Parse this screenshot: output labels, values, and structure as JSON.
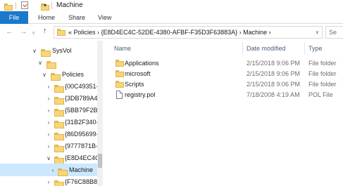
{
  "window": {
    "title": "Machine",
    "quick_access_dropdown": "▾"
  },
  "ribbon": {
    "tabs": [
      {
        "label": "File"
      },
      {
        "label": "Home"
      },
      {
        "label": "Share"
      },
      {
        "label": "View"
      }
    ]
  },
  "nav": {
    "back": "←",
    "forward": "→",
    "recent": "∨",
    "up": "↑"
  },
  "address": {
    "path": "«  Policies  ›  {E8D4EC4C-52DE-4380-AFBF-F35D3F63883A}  ›  Machine  ›",
    "chevron": "∨"
  },
  "search": {
    "placeholder": "Se"
  },
  "tree": [
    {
      "label": "SysVol",
      "arrow": "∨"
    },
    {
      "label": "",
      "arrow": "∨"
    },
    {
      "label": "Policies",
      "arrow": "∨"
    },
    {
      "label": "{00C49351-",
      "arrow": "›"
    },
    {
      "label": "{3DB789A4",
      "arrow": "›"
    },
    {
      "label": "{5BB79F2B-",
      "arrow": "›"
    },
    {
      "label": "{31B2F340-",
      "arrow": "›"
    },
    {
      "label": "{86D95699-",
      "arrow": "›"
    },
    {
      "label": "{9777871B-",
      "arrow": "›"
    },
    {
      "label": "{E8D4EC4C",
      "arrow": "∨"
    },
    {
      "label": "Machine",
      "arrow": "›"
    },
    {
      "label": "{F76C88B8-",
      "arrow": "›"
    }
  ],
  "columns": {
    "name": "Name",
    "date": "Date modified",
    "type": "Type"
  },
  "files": [
    {
      "name": "Applications",
      "date": "2/15/2018 9:06 PM",
      "type": "File folder",
      "icon": "folder-icon"
    },
    {
      "name": "microsoft",
      "date": "2/15/2018 9:06 PM",
      "type": "File folder",
      "icon": "folder-icon"
    },
    {
      "name": "Scripts",
      "date": "2/15/2018 9:06 PM",
      "type": "File folder",
      "icon": "folder-icon"
    },
    {
      "name": "registry.pol",
      "date": "7/18/2008 4:19 AM",
      "type": "POL File",
      "icon": "document-icon"
    }
  ],
  "colors": {
    "file_tab": "#1979ca",
    "selection": "#cce8ff",
    "folder": "#f7d67a"
  }
}
